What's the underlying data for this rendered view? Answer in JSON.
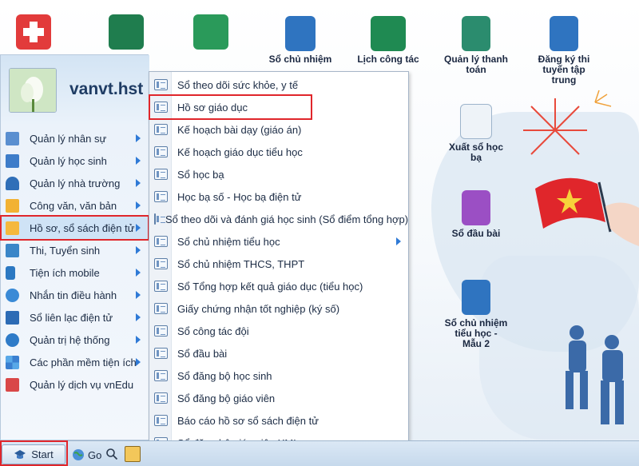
{
  "desktop": {
    "icons": [
      {
        "label": "Sổ chủ nhiệm",
        "icon": "notebook-gvcn-icon"
      },
      {
        "label": "Lịch công tác",
        "icon": "calendar-icon"
      },
      {
        "label": "Quản lý thanh toán",
        "icon": "payment-phone-icon"
      },
      {
        "label": "Đăng ký thi tuyển tập trung",
        "icon": "registration-list-icon"
      },
      {
        "label": "Xuất sổ học bạ",
        "icon": "export-transcript-icon"
      },
      {
        "label": "Sổ đầu bài",
        "icon": "class-log-book-icon"
      },
      {
        "label": "Sổ chủ nhiệm tiểu học - Mẫu 2",
        "icon": "notebook-gvcn-icon"
      }
    ],
    "top_icon_labels": [
      "",
      "",
      ""
    ]
  },
  "start_menu": {
    "username": "vanvt.hst",
    "items": [
      {
        "label": "Quản lý nhân sự",
        "icon": "staff-icon",
        "has_submenu": true
      },
      {
        "label": "Quản lý học sinh",
        "icon": "students-icon",
        "has_submenu": true
      },
      {
        "label": "Quản lý nhà trường",
        "icon": "school-icon",
        "has_submenu": true
      },
      {
        "label": "Công văn, văn bản",
        "icon": "documents-icon",
        "has_submenu": true
      },
      {
        "label": "Hồ sơ, sổ sách điện tử",
        "icon": "folder-icon",
        "has_submenu": true,
        "selected": true
      },
      {
        "label": "Thi, Tuyển sinh",
        "icon": "exam-icon",
        "has_submenu": true
      },
      {
        "label": "Tiện ích mobile",
        "icon": "mobile-icon",
        "has_submenu": true
      },
      {
        "label": "Nhắn tin điều hành",
        "icon": "message-icon",
        "has_submenu": true
      },
      {
        "label": "Sổ liên lạc điện tử",
        "icon": "contact-book-icon",
        "has_submenu": true
      },
      {
        "label": "Quản trị hệ thống",
        "icon": "system-admin-icon",
        "has_submenu": true
      },
      {
        "label": "Các phần mềm tiện ích",
        "icon": "apps-grid-icon",
        "has_submenu": true
      },
      {
        "label": "Quản lý dịch vụ vnEdu",
        "icon": "vnedu-service-icon",
        "has_submenu": false
      }
    ]
  },
  "submenu": {
    "items": [
      {
        "label": "Sổ theo dõi sức khỏe, y tế"
      },
      {
        "label": "Hồ sơ giáo dục",
        "highlighted": true
      },
      {
        "label": "Kế hoạch bài dạy (giáo án)"
      },
      {
        "label": "Kế hoạch giáo dục tiểu học"
      },
      {
        "label": "Sổ học bạ"
      },
      {
        "label": "Học bạ số - Học bạ điện tử"
      },
      {
        "label": "Sổ theo dõi và đánh giá học sinh (Sổ điểm tổng hợp)"
      },
      {
        "label": "Sổ chủ nhiệm tiểu học",
        "has_submenu": true
      },
      {
        "label": "Sổ chủ nhiệm THCS, THPT"
      },
      {
        "label": "Sổ Tổng hợp kết quả giáo dục (tiểu học)"
      },
      {
        "label": "Giấy chứng nhận tốt nghiệp (ký số)"
      },
      {
        "label": "Sổ công tác đội"
      },
      {
        "label": "Sổ đầu bài"
      },
      {
        "label": "Sổ đăng bộ học sinh"
      },
      {
        "label": "Sổ đăng bộ giáo viên"
      },
      {
        "label": "Báo cáo hồ sơ sổ sách điện tử"
      },
      {
        "label": "Sổ đăng bộ giáo viên XML"
      }
    ]
  },
  "taskbar": {
    "start_label": "Start",
    "go_label": "Go"
  },
  "colors": {
    "highlight_red": "#e0262b",
    "menu_blue": "#2f7ad6",
    "panel_bg": "#e9f1fa"
  }
}
